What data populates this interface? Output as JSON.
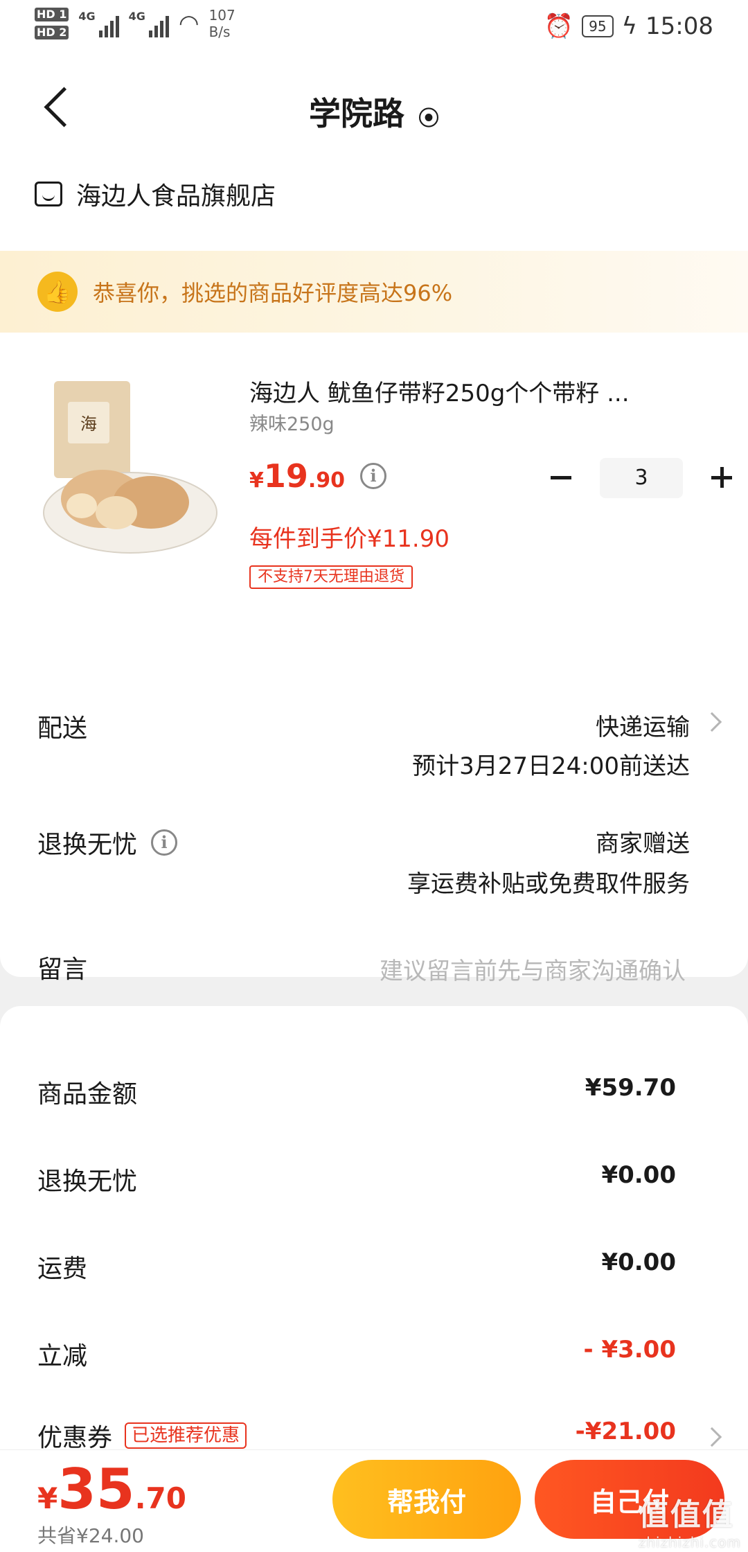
{
  "status_bar": {
    "sim1": "HD 1",
    "sim2": "HD 2",
    "net1": "4G",
    "net2": "4G",
    "speed_value": "107",
    "speed_unit": "B/s",
    "battery": "95",
    "time": "15:08"
  },
  "nav": {
    "title": "学院路"
  },
  "store": {
    "name": "海边人食品旗舰店"
  },
  "banner": {
    "text": "恭喜你，挑选的商品好评度高达96%"
  },
  "product": {
    "title": "海边人 鱿鱼仔带籽250g个个带籽 ...",
    "spec": "辣味250g",
    "price_currency": "¥",
    "price_int": "19",
    "price_dec": ".90",
    "unit_price": "每件到手价¥11.90",
    "tag": "不支持7天无理由退货",
    "quantity": "3"
  },
  "delivery": {
    "label": "配送",
    "method": "快递运输",
    "eta": "预计3月27日24:00前送达"
  },
  "refund": {
    "label": "退换无忧",
    "value1": "商家赠送",
    "value2": "享运费补贴或免费取件服务"
  },
  "note": {
    "label": "留言",
    "placeholder": "建议留言前先与商家沟通确认"
  },
  "summary": [
    {
      "label": "商品金额",
      "value": "¥59.70"
    },
    {
      "label": "退换无忧",
      "value": "¥0.00"
    },
    {
      "label": "运费",
      "value": "¥0.00"
    },
    {
      "label": "立减",
      "value": "- ¥3.00"
    },
    {
      "label": "优惠券",
      "tag": "已选推荐优惠",
      "value": "-¥21.00"
    }
  ],
  "bottom": {
    "total_currency": "¥",
    "total_int": "35",
    "total_dec": ".70",
    "saved": "共省¥24.00",
    "help_pay": "帮我付",
    "self_pay": "自己付"
  },
  "watermark": {
    "text": "值值值",
    "sub": "zhizhizhi.com"
  },
  "colors": {
    "accent_red": "#e8331e",
    "banner_orange": "#c7741a",
    "help_button": "#ffb01a",
    "self_button": "#f33a1e"
  }
}
